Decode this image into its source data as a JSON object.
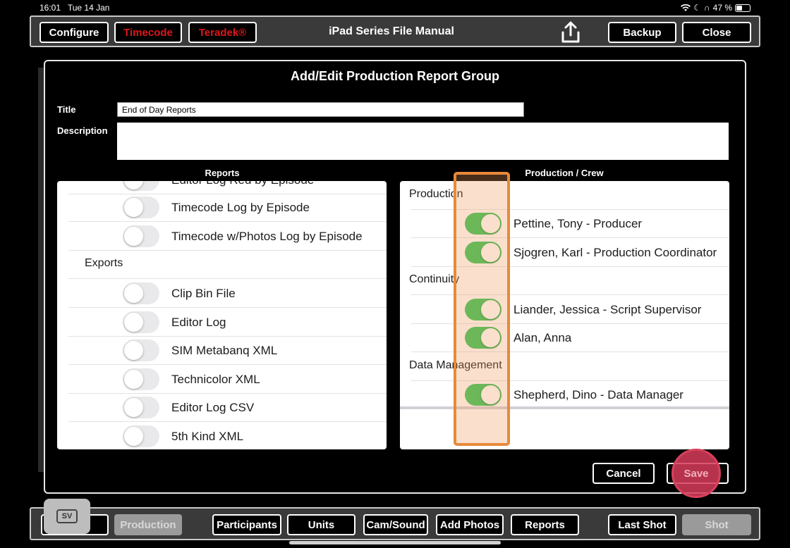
{
  "status": {
    "time": "16:01",
    "date": "Tue 14 Jan",
    "battery": "47 %",
    "battery_level": 0.47
  },
  "toolbar": {
    "configure": "Configure",
    "timecode": "Timecode",
    "teradek": "Teradek®",
    "title": "iPad Series File Manual",
    "backup": "Backup",
    "close": "Close"
  },
  "modal": {
    "title": "Add/Edit Production Report Group",
    "title_label": "Title",
    "title_value": "End of Day Reports",
    "description_label": "Description",
    "description_value": "",
    "reports_header": "Reports",
    "crew_header": "Production / Crew",
    "cancel": "Cancel",
    "save": "Save"
  },
  "reports": {
    "partial_item": "Editor Log Red by Episode",
    "items_top": [
      {
        "label": "Timecode Log by Episode",
        "on": false
      },
      {
        "label": "Timecode w/Photos Log by Episode",
        "on": false
      }
    ],
    "exports_label": "Exports",
    "exports": [
      {
        "label": "Clip Bin File",
        "on": false
      },
      {
        "label": "Editor Log",
        "on": false
      },
      {
        "label": "SIM Metabanq XML",
        "on": false
      },
      {
        "label": "Technicolor XML",
        "on": false
      },
      {
        "label": "Editor Log CSV",
        "on": false
      },
      {
        "label": "5th Kind XML",
        "on": false
      }
    ]
  },
  "crew": {
    "groups": [
      {
        "name": "Production",
        "members": [
          {
            "label": "Pettine, Tony - Producer",
            "on": true
          },
          {
            "label": "Sjogren, Karl - Production Coordinator",
            "on": true
          }
        ]
      },
      {
        "name": "Continuity",
        "members": [
          {
            "label": "Liander, Jessica - Script Supervisor",
            "on": true
          },
          {
            "label": "Alan, Anna",
            "on": true
          }
        ]
      },
      {
        "name": "Data Management",
        "members": [
          {
            "label": "Shepherd, Dino - Data Manager",
            "on": true
          }
        ]
      }
    ]
  },
  "bottom": {
    "sv": "SV",
    "production": "Production",
    "participants": "Participants",
    "units": "Units",
    "cam_sound": "Cam/Sound",
    "add_photos": "Add Photos",
    "reports": "Reports",
    "last_shot": "Last Shot",
    "shot": "Shot"
  },
  "colors": {
    "toggle_on": "#34c759",
    "highlight": "#e8893a",
    "accent_red": "#e0161b"
  }
}
